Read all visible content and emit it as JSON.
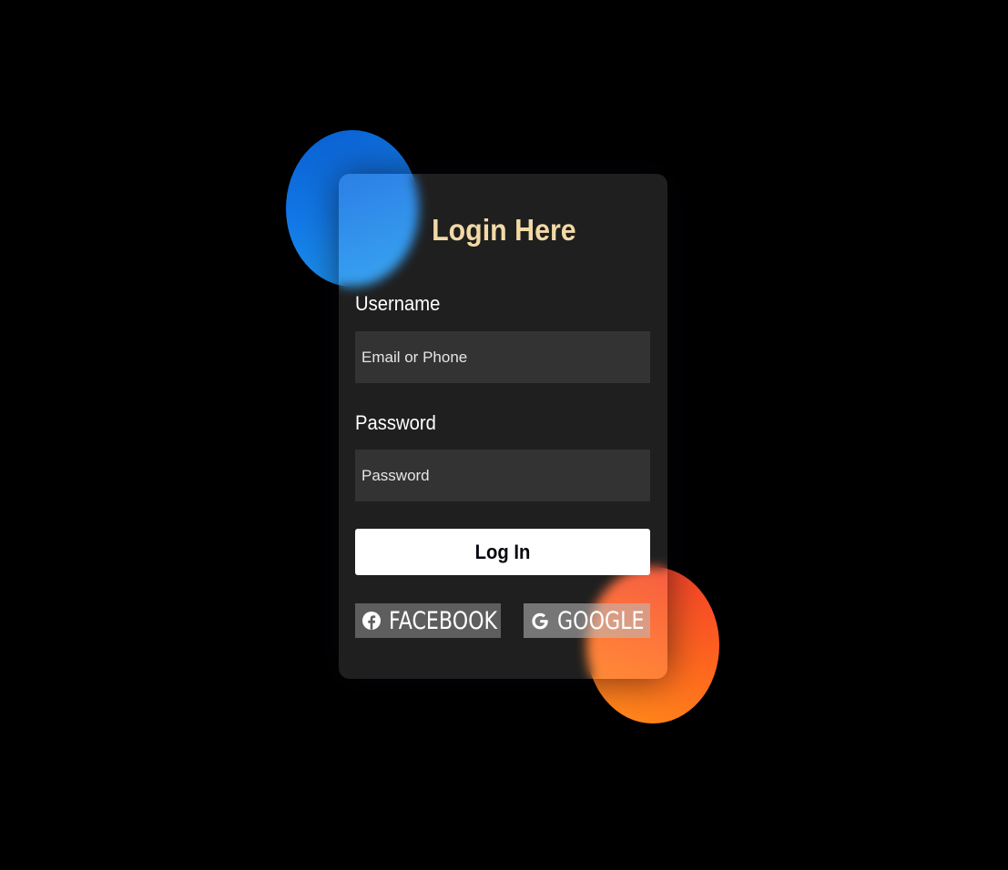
{
  "form": {
    "title": "Login Here",
    "username_label": "Username",
    "username_placeholder": "Email or Phone",
    "password_label": "Password",
    "password_placeholder": "Password",
    "login_label": "Log In"
  },
  "social": {
    "facebook": {
      "label": "FACEBOOK",
      "icon": "facebook-icon"
    },
    "google": {
      "label": "GOOGLE",
      "icon": "google-icon"
    }
  },
  "colors": {
    "background": "#000000",
    "title": "#f2d9a6",
    "blob_blue": "#1277e6",
    "blob_orange": "#ff6a1e",
    "button": "#ffffff"
  }
}
